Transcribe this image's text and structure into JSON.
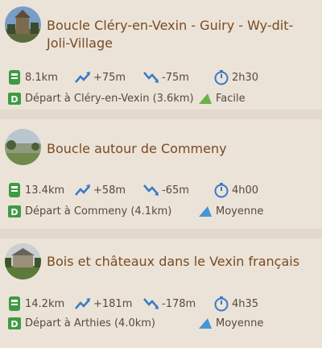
{
  "routes": [
    {
      "title": "Boucle Cléry-en-Vexin - Guiry - Wy-dit-Joli-Village",
      "distance": "8.1km",
      "ascent": "+75m",
      "descent": "-75m",
      "duration": "2h30",
      "start": "Départ à Cléry-en-Vexin (3.6km)",
      "difficulty": "Facile"
    },
    {
      "title": "Boucle autour de Commeny",
      "distance": "13.4km",
      "ascent": "+58m",
      "descent": "-65m",
      "duration": "4h00",
      "start": "Départ à Commeny (4.1km)",
      "difficulty": "Moyenne"
    },
    {
      "title": "Bois et châteaux dans le Vexin français",
      "distance": "14.2km",
      "ascent": "+181m",
      "descent": "-178m",
      "duration": "4h35",
      "start": "Départ à Arthies (4.0km)",
      "difficulty": "Moyenne"
    }
  ],
  "colors": {
    "title": "#7b4a22",
    "icon_green": "#3f9a45",
    "icon_blue": "#3a79c8",
    "easy_triangle": "#6bb04a",
    "medium_triangle": "#4a94d6"
  },
  "icons": [
    "distance-icon",
    "ascent-icon",
    "descent-icon",
    "duration-icon",
    "start-icon",
    "difficulty-icon"
  ]
}
